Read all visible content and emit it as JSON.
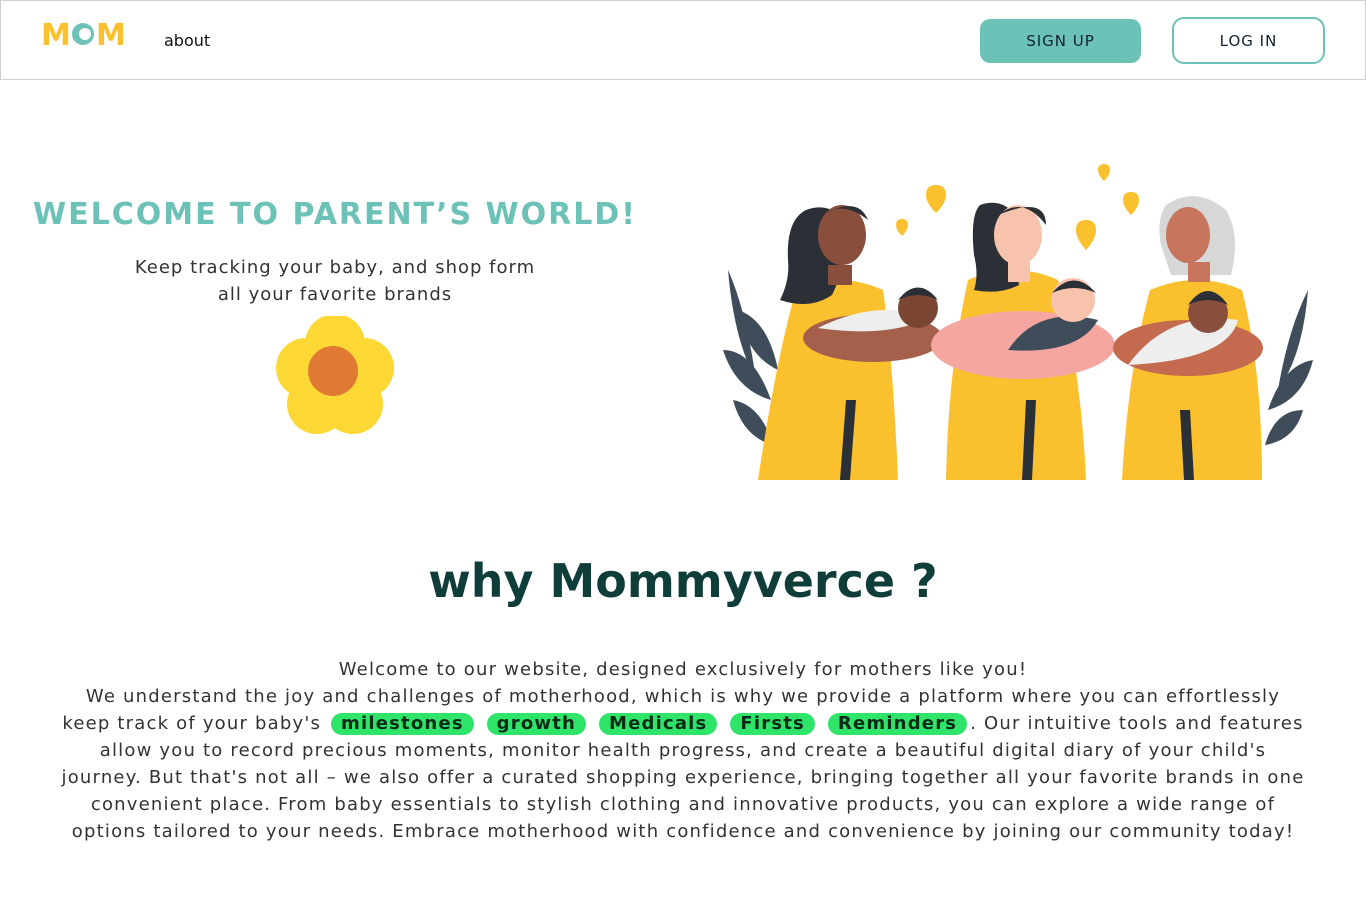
{
  "header": {
    "logo_text": "MOM",
    "nav_about": "about",
    "signup_label": "SIGN UP",
    "login_label": "LOG IN"
  },
  "hero": {
    "title": "WELCOME TO PARENT’S WORLD!",
    "subtitle_line1": "Keep tracking your baby, and shop form",
    "subtitle_line2": "all your favorite brands"
  },
  "why": {
    "title": "why Mommyverce ?",
    "line1": "Welcome to our website, designed exclusively for mothers like you!",
    "p_before_tags": "We understand the joy and challenges of motherhood, which is why we provide a platform where you can effortlessly keep track of your baby's",
    "tags": [
      "milestones",
      "growth",
      "Medicals",
      "Firsts",
      "Reminders"
    ],
    "p_after_tags": ". Our intuitive tools and features allow you to record precious moments, monitor health progress, and create a beautiful digital diary of your child's journey. But that's not all – we also offer a curated shopping experience, bringing together all your favorite brands in one convenient place. From baby essentials to stylish clothing and innovative products, you can explore a wide range of options tailored to your needs. Embrace motherhood with confidence and convenience by joining our community today!"
  },
  "colors": {
    "accent": "#6cc2b7",
    "title_dark": "#0f3d3a",
    "tag_green": "#2ee56a",
    "flower_yellow": "#fdd835",
    "flower_center": "#e07a33",
    "scrub_yellow": "#fbc02d"
  }
}
